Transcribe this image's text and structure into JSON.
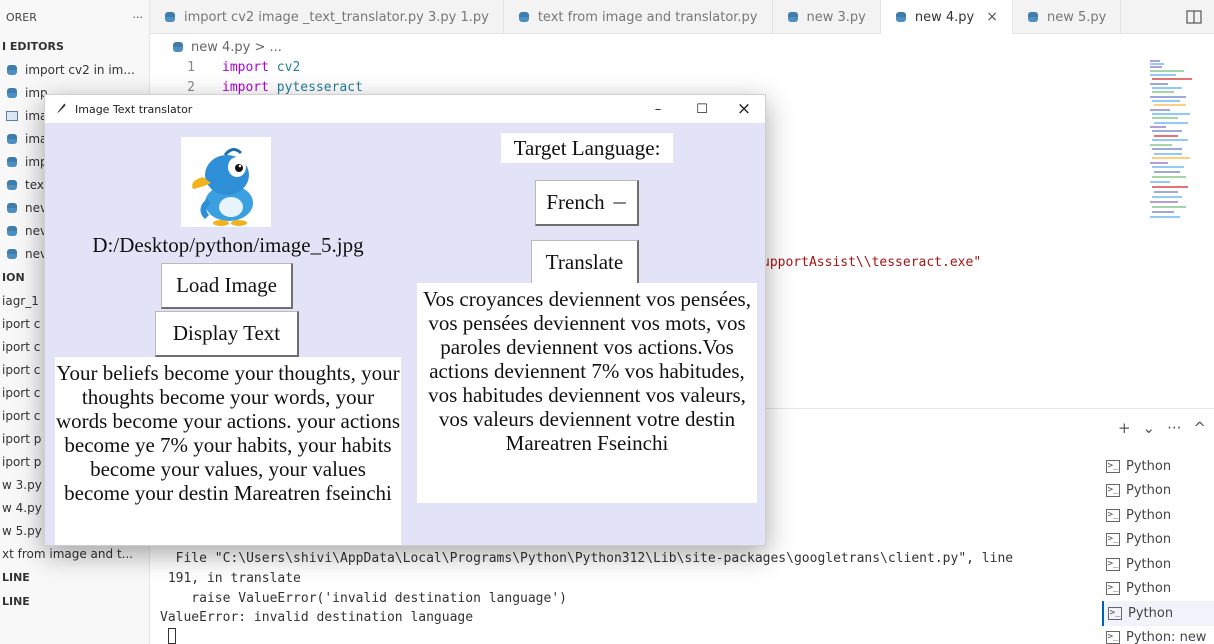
{
  "sidebar": {
    "title": "ORER",
    "more": "···",
    "section": "I EDITORS",
    "items": [
      {
        "icon": "python-file-icon",
        "label": "import cv2 in im..."
      },
      {
        "icon": "python-file-icon",
        "label": "imp"
      },
      {
        "icon": "image-file-icon",
        "label": "ima"
      },
      {
        "icon": "python-file-icon",
        "label": "ima"
      },
      {
        "icon": "python-file-icon",
        "label": "imp"
      },
      {
        "icon": "python-file-icon",
        "label": "tex"
      },
      {
        "icon": "python-file-icon",
        "label": "nev"
      },
      {
        "icon": "python-file-icon",
        "label": "nev"
      },
      {
        "icon": "python-file-icon",
        "label": "nev"
      }
    ],
    "section2": "ION",
    "files": [
      "iagr_1",
      "iport c",
      "iport c",
      "iport c",
      "iport c",
      "iport c",
      "iport p",
      "iport p",
      "w 3.py",
      "w 4.py",
      "w 5.py",
      "xt from image and t..."
    ],
    "outline": "LINE",
    "timeline": "LINE"
  },
  "tabs": [
    {
      "label": "import cv2 image _text_translator.py  3.py 1.py",
      "active": false
    },
    {
      "label": "text from image and translator.py",
      "active": false
    },
    {
      "label": "new 3.py",
      "active": false
    },
    {
      "label": "new 4.py",
      "active": true,
      "close": "×"
    },
    {
      "label": "new 5.py",
      "active": false
    }
  ],
  "editor": {
    "breadcrumb": "new 4.py > ...",
    "lines": [
      {
        "n": "1",
        "kw": "import",
        "mod": "cv2"
      },
      {
        "n": "2",
        "kw": "import",
        "mod": "pytesseract"
      }
    ],
    "path_fragment": "upportAssist\\\\tesseract.exe\""
  },
  "terminal": {
    "lines": [
      "  File \"C:\\Users\\shivi\\AppData\\Local\\Programs\\Python\\Python312\\Lib\\site-packages\\googletrans\\client.py\", line",
      " 191, in translate",
      "    raise ValueError('invalid destination language')",
      "ValueError: invalid destination language"
    ],
    "actions": [
      "+",
      "⌄",
      "···",
      "^"
    ],
    "instances": [
      "Python",
      "Python",
      "Python",
      "Python",
      "Python",
      "Python",
      "Python",
      "Python: new"
    ],
    "active_index": 6
  },
  "app": {
    "title": "Image Text translator",
    "controls": {
      "minimize": "–",
      "maximize": "☐",
      "close": "×"
    },
    "image_path": "D:/Desktop/python/image_5.jpg",
    "load_label": "Load Image",
    "display_label": "Display Text",
    "extracted_text": "Your beliefs become your thoughts, your thoughts become your words, your words become your actions. your actions become ye 7% your habits, your habits become your values, your values become your destin Mareatren fseinchi",
    "target_label": "Target Language:",
    "language": "French",
    "menu_indicator": "—",
    "translate_label": "Translate",
    "translated_text": "Vos croyances deviennent vos pensées, vos pensées deviennent vos mots, vos paroles deviennent vos actions.Vos actions deviennent 7% vos habitudes, vos habitudes deviennent vos valeurs, vos valeurs deviennent votre destin Mareatren Fseinchi"
  }
}
